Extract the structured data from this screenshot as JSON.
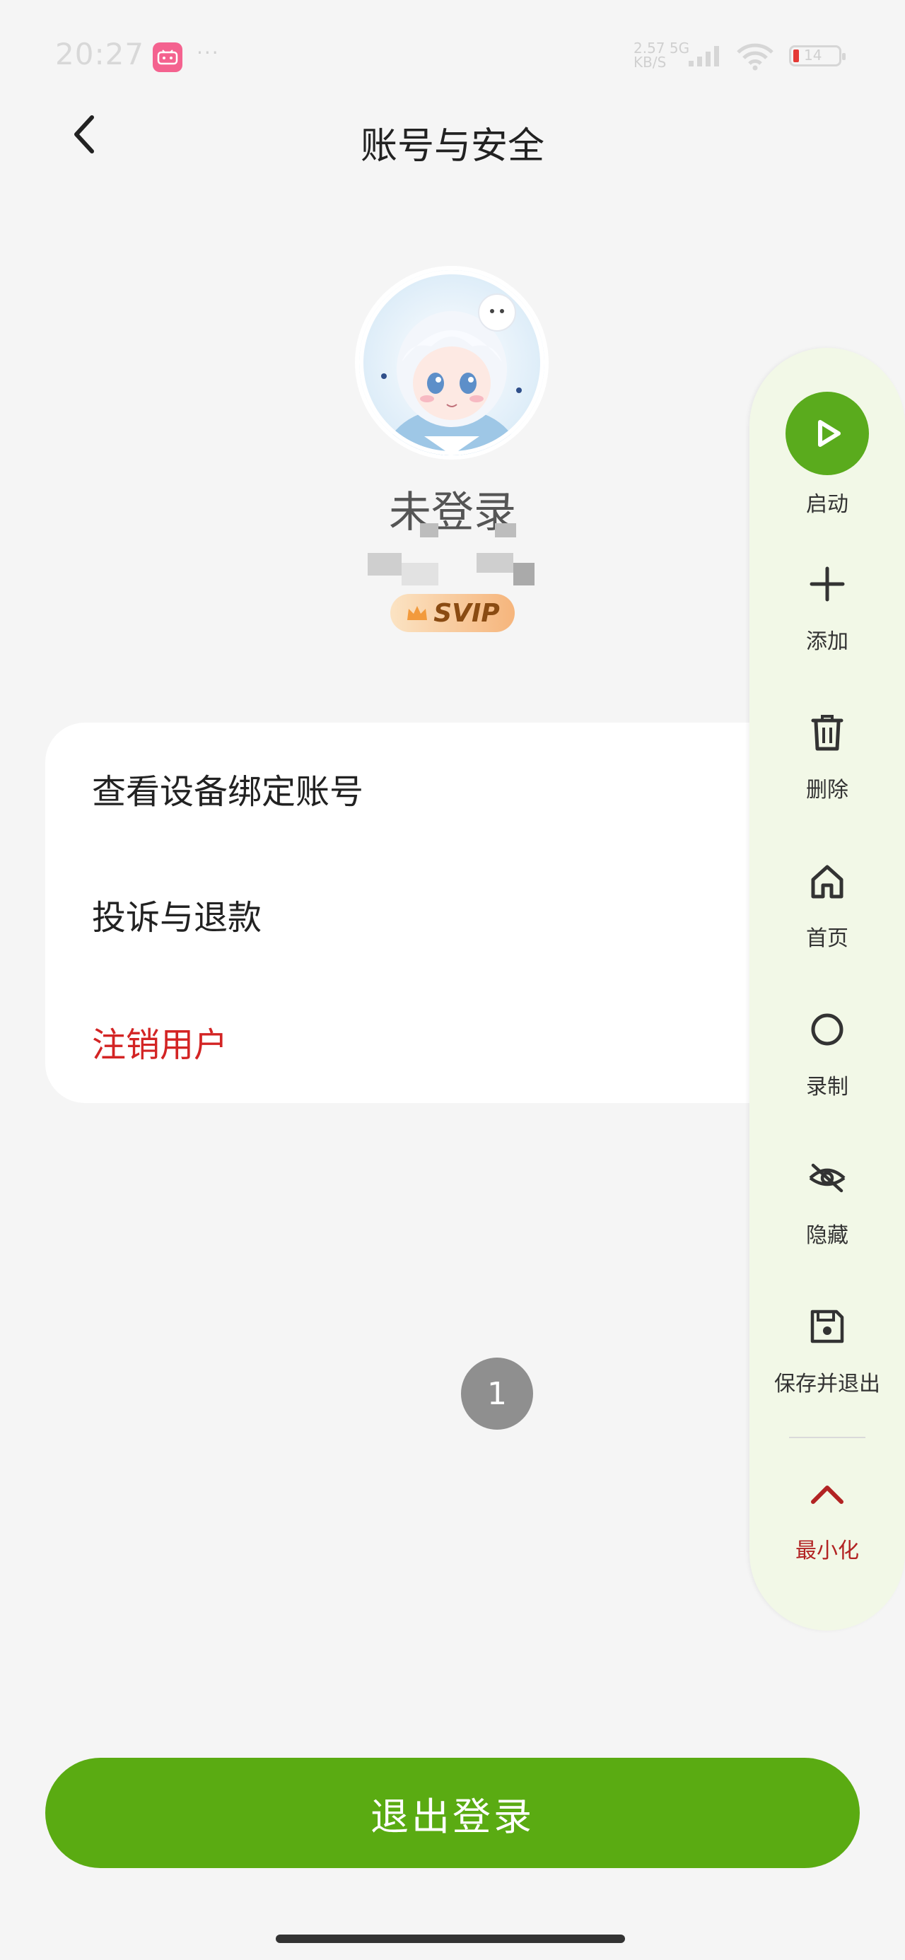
{
  "status_bar": {
    "time": "20:27",
    "app_badge": "bilibili",
    "dots": "···",
    "net_speed_value": "2.57",
    "net_speed_unit": "KB/S",
    "network_type": "5G",
    "battery_level": "14"
  },
  "nav": {
    "title": "账号与安全"
  },
  "profile": {
    "name": "未登录",
    "svip_label": "SVIP"
  },
  "menu": {
    "items": [
      {
        "label": "查看设备绑定账号"
      },
      {
        "label": "投诉与退款"
      },
      {
        "label": "注销用户"
      }
    ]
  },
  "pager": {
    "current": "1"
  },
  "float_panel": {
    "items": [
      {
        "label": "启动",
        "icon": "play-icon"
      },
      {
        "label": "添加",
        "icon": "plus-icon"
      },
      {
        "label": "删除",
        "icon": "trash-icon"
      },
      {
        "label": "首页",
        "icon": "home-icon"
      },
      {
        "label": "录制",
        "icon": "record-icon"
      },
      {
        "label": "隐藏",
        "icon": "eye-off-icon"
      },
      {
        "label": "保存并退出",
        "icon": "save-icon"
      },
      {
        "label": "最小化",
        "icon": "chevron-up-icon"
      }
    ]
  },
  "logout": {
    "label": "退出登录"
  },
  "colors": {
    "accent_green": "#5aab12",
    "danger_red": "#d32424",
    "panel_bg": "#f2f8e7"
  }
}
